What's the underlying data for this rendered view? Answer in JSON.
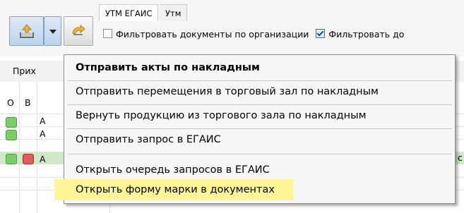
{
  "tabs": [
    {
      "label": "УТМ ЕГАИС",
      "active": true
    },
    {
      "label": "Утм",
      "active": false
    }
  ],
  "filters": [
    {
      "label": "Фильтровать документы по организации",
      "checked": false
    },
    {
      "label": "Фильтровать до",
      "checked": true
    }
  ],
  "background": {
    "tab_label": "Прих",
    "columns": [
      "О",
      "В"
    ],
    "row_cells": [
      "А",
      "А",
      "А"
    ],
    "right_cut_text": "с"
  },
  "menu": {
    "items": [
      {
        "label": "Отправить акты по накладным",
        "bold": true
      },
      {
        "label": "Отправить перемещения в торговый зал по накладным"
      },
      {
        "label": "Вернуть продукцию из торгового зала по накладным"
      },
      {
        "label": "Отправить запрос в ЕГАИС"
      },
      {
        "label": "Открыть очередь запросов в ЕГАИС"
      },
      {
        "label": "Открыть форму марки в документах",
        "highlighted": true
      }
    ]
  },
  "icons": {
    "upload": "upload-tray-icon",
    "dropdown": "triangle-down-icon",
    "refresh": "refresh-arrow-icon"
  },
  "colors": {
    "menu_highlight": "#fdf596",
    "status_green": "#7ccd6a",
    "status_red": "#e05b5b",
    "toolbar_pressed": "#bcd3ec"
  }
}
